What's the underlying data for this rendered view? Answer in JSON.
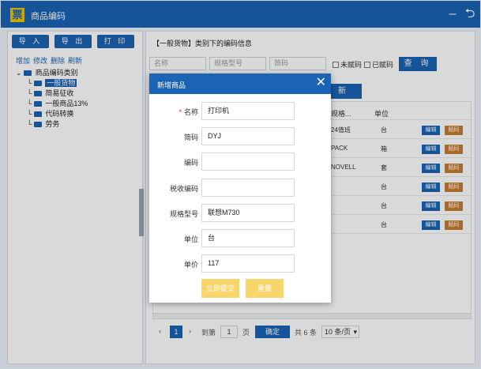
{
  "app": {
    "logo_char": "票",
    "title": "商品编码"
  },
  "window_controls": {
    "minimize": "–",
    "back": "⮌"
  },
  "left_panel": {
    "buttons": [
      "导 入",
      "导 出",
      "打 印"
    ],
    "links": [
      "增加",
      "修改",
      "删除",
      "刷新"
    ],
    "tree": {
      "root": "商品编码类别",
      "items": [
        "一般货物",
        "简易征收",
        "一般商品13%",
        "代码转换",
        "劳务"
      ],
      "selected": "一般货物"
    }
  },
  "right_panel": {
    "info": "【一般货物】类别下的编码信息",
    "search": {
      "name_placeholder": "名称",
      "spec_placeholder": "规格型号",
      "short_placeholder": "简码"
    },
    "filters": {
      "uncoded": "未赋码",
      "coded": "已赋码"
    },
    "query_button": "查 询",
    "add_button": "新",
    "columns": {
      "spec": "规格...",
      "unit": "单位"
    },
    "rows": [
      {
        "spec": "24值班",
        "unit": "台"
      },
      {
        "spec": "PACK",
        "unit": "箱"
      },
      {
        "spec": "NOVELL",
        "unit": "套"
      },
      {
        "spec": "",
        "unit": "台"
      },
      {
        "spec": "",
        "unit": "台"
      },
      {
        "spec": "",
        "unit": "台"
      }
    ],
    "row_actions": {
      "edit": "编辑",
      "code": "赋码"
    },
    "pager": {
      "current_page": "1",
      "goto_label": "到第",
      "page_input": "1",
      "page_unit": "页",
      "confirm": "确定",
      "total": "共 6 条",
      "page_size": "10 条/页"
    }
  },
  "dialog": {
    "title": "新增商品",
    "close": "✕",
    "fields": [
      {
        "label": "名称",
        "value": "打印机",
        "required": true
      },
      {
        "label": "简码",
        "value": "DYJ",
        "required": false
      },
      {
        "label": "编码",
        "value": "",
        "required": false
      },
      {
        "label": "税收编码",
        "value": "",
        "required": false
      },
      {
        "label": "规格型号",
        "value": "联想M730",
        "required": false
      },
      {
        "label": "单位",
        "value": "台",
        "required": false
      },
      {
        "label": "单价",
        "value": "117",
        "required": false
      }
    ],
    "submit": "立即提交",
    "reset": "重置"
  },
  "colors": {
    "primary": "#1b63b4",
    "accent_yellow": "#f9d66b",
    "delete_orange": "#c97d2e"
  }
}
